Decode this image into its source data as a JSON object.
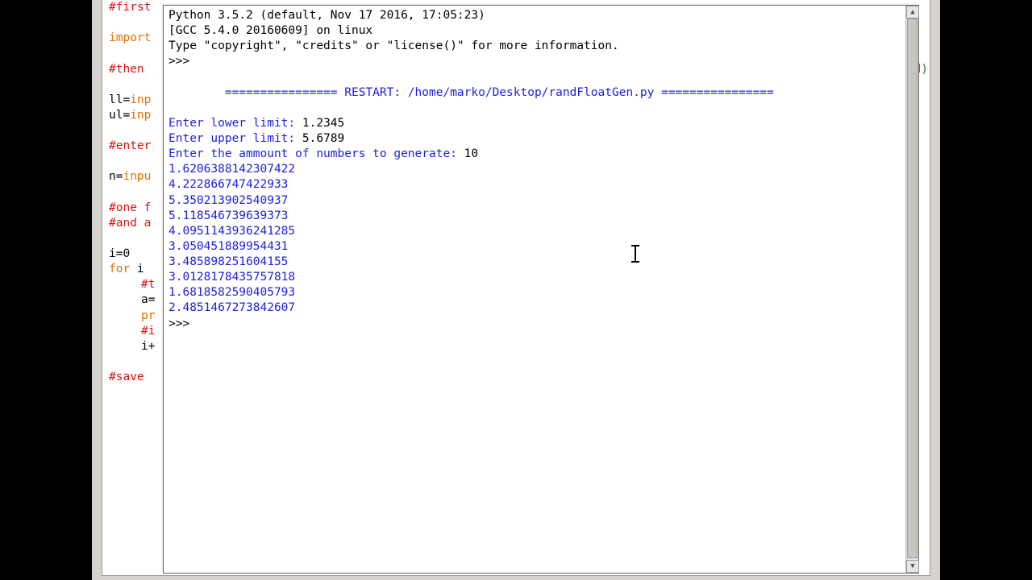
{
  "editor": {
    "line1_comment": "#first",
    "line2_kw": "import",
    "line3_comment": "#then ",
    "line3_tail": "fined)",
    "line4_var": "ll=",
    "line4_kw": "inp",
    "line5_var": "ul=",
    "line5_kw": "inp",
    "line6_comment": "#enter",
    "line7_var": "n=",
    "line7_kw": "inpu",
    "line8_comment": "#one f",
    "line9_comment": "#and a",
    "line10_var": "i=0",
    "line11_kw": "for ",
    "line11_var": "i ",
    "line12_comment": "#t",
    "line13_var": "a=",
    "line14_kw": "pr",
    "line15_comment": "#i",
    "line16_var": "i+",
    "line17_comment": "#save"
  },
  "shell": {
    "banner1": "Python 3.5.2 (default, Nov 17 2016, 17:05:23) ",
    "banner2": "[GCC 5.4.0 20160609] on linux",
    "banner3": "Type \"copyright\", \"credits\" or \"license()\" for more information.",
    "prompt1": ">>> ",
    "restart_deco_l": "================ ",
    "restart_label": "RESTART: /home/marko/Desktop/randFloatGen.py ",
    "restart_deco_r": "================",
    "input1_prompt": "Enter lower limit: ",
    "input1_val": "1.2345",
    "input2_prompt": "Enter upper limit: ",
    "input2_val": "5.6789",
    "input3_prompt": "Enter the ammount of numbers to generate: ",
    "input3_val": "10",
    "out": [
      "1.6206388142307422",
      "4.222866747422933",
      "5.350213902540937",
      "5.118546739639373",
      "4.0951143936241285",
      "3.050451889954431",
      "3.485898251604155",
      "3.0128178435757818",
      "1.6818582590405793",
      "2.4851467273842607"
    ],
    "prompt2": ">>> "
  }
}
